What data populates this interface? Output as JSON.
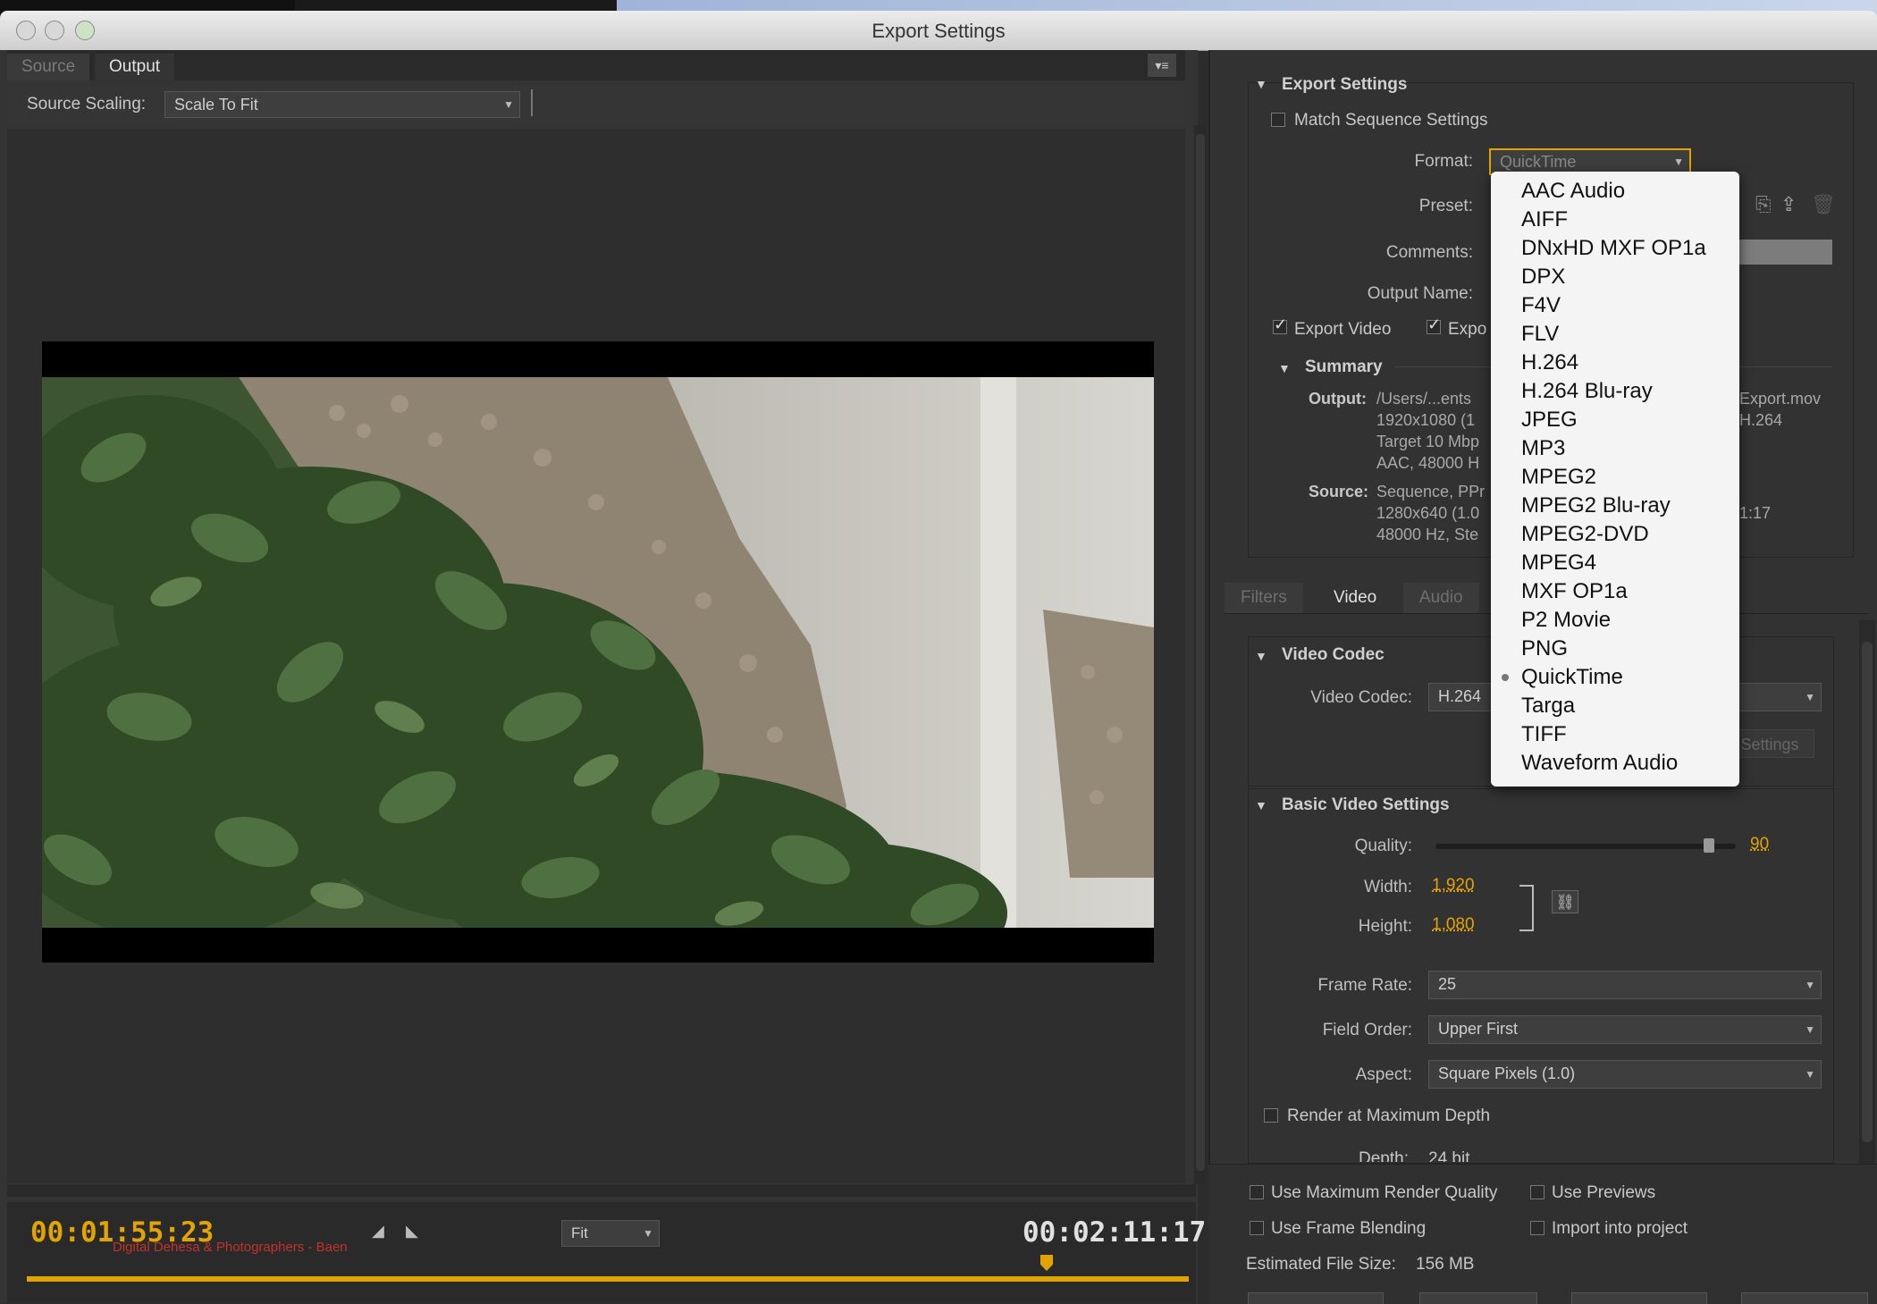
{
  "window": {
    "title": "Export Settings"
  },
  "left": {
    "tabs": [
      "Source",
      "Output"
    ],
    "source_scaling_label": "Source Scaling:",
    "source_scaling_value": "Scale To Fit",
    "current_time": "00:01:55:23",
    "duration": "00:02:11:17",
    "zoom_value": "Fit",
    "overlay_text": "Digital Dehesa & Photographers - Baen"
  },
  "export_settings": {
    "header": "Export Settings",
    "match_sequence": "Match Sequence Settings",
    "format_label": "Format:",
    "format_value": "QuickTime",
    "preset_label": "Preset:",
    "comments_label": "Comments:",
    "output_name_label": "Output Name:",
    "export_video": "Export Video",
    "export_audio_partial": "Expo",
    "summary_header": "Summary",
    "output_label": "Output:",
    "output_lines": [
      "/Users/...ents",
      "1920x1080 (1",
      "Target 10 Mbp",
      "AAC, 48000 H"
    ],
    "output_right": [
      "Export.mov",
      "H.264"
    ],
    "source_label": "Source:",
    "source_lines": [
      "Sequence, PPr",
      "1280x640 (1.0",
      "48000 Hz, Ste"
    ],
    "source_right": "1:17"
  },
  "tabs": [
    "Filters",
    "Video",
    "Audio"
  ],
  "video_codec": {
    "header": "Video Codec",
    "label": "Video Codec:",
    "value": "H.264",
    "settings_button": "Settings"
  },
  "basic_video": {
    "header": "Basic Video Settings",
    "quality_label": "Quality:",
    "quality_value": "90",
    "quality_fraction": 0.9,
    "width_label": "Width:",
    "width_value": "1,920",
    "height_label": "Height:",
    "height_value": "1,080",
    "frame_rate_label": "Frame Rate:",
    "frame_rate_value": "25",
    "field_order_label": "Field Order:",
    "field_order_value": "Upper First",
    "aspect_label": "Aspect:",
    "aspect_value": "Square Pixels (1.0)",
    "render_max_depth": "Render at Maximum Depth",
    "depth_label": "Depth:",
    "depth_value": "24 bit"
  },
  "bottom": {
    "use_max_render": "Use Maximum Render Quality",
    "use_previews": "Use Previews",
    "use_frame_blending": "Use Frame Blending",
    "import_into_project": "Import into project",
    "estimated_size_label": "Estimated File Size:",
    "estimated_size_value": "156 MB"
  },
  "format_menu": {
    "items": [
      "AAC Audio",
      "AIFF",
      "DNxHD MXF OP1a",
      "DPX",
      "F4V",
      "FLV",
      "H.264",
      "H.264 Blu-ray",
      "JPEG",
      "MP3",
      "MPEG2",
      "MPEG2 Blu-ray",
      "MPEG2-DVD",
      "MPEG4",
      "MXF OP1a",
      "P2 Movie",
      "PNG",
      "QuickTime",
      "Targa",
      "TIFF",
      "Waveform Audio"
    ],
    "selected": "QuickTime"
  },
  "colors": {
    "accent": "#e2a400",
    "panel": "#323232",
    "menu_bg": "#f4f4f4"
  },
  "icons": [
    "panel-menu-icon",
    "mark-in-icon",
    "mark-out-icon",
    "playhead-icon",
    "link-icon",
    "save-preset-icon",
    "delete-preset-icon",
    "import-preset-icon",
    "close-light",
    "minimize-light",
    "zoom-light"
  ]
}
